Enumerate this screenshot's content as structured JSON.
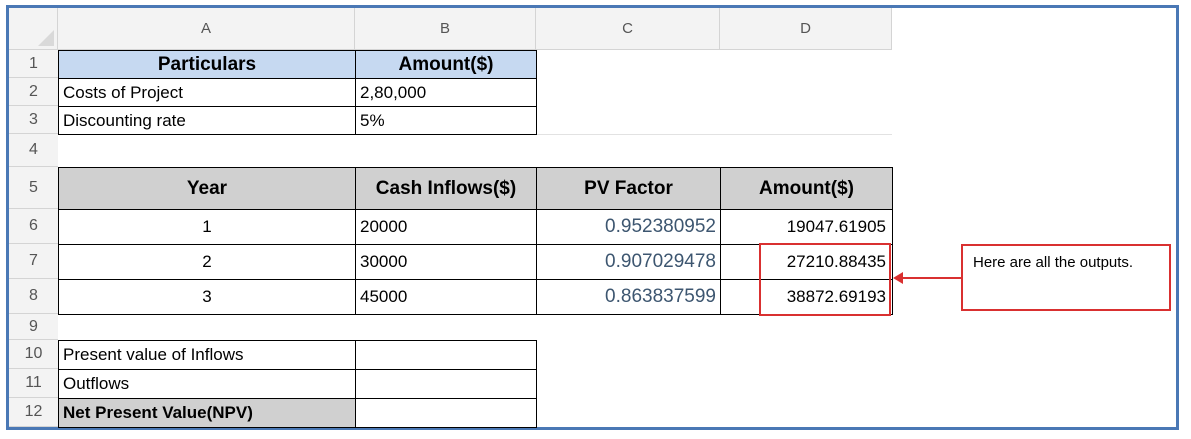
{
  "columns": [
    "A",
    "B",
    "C",
    "D"
  ],
  "rows": [
    "1",
    "2",
    "3",
    "4",
    "5",
    "6",
    "7",
    "8",
    "9",
    "10",
    "11",
    "12"
  ],
  "table1": {
    "header": {
      "particulars": "Particulars",
      "amount": "Amount($)"
    },
    "rows": [
      {
        "label": "Costs of Project",
        "value": "2,80,000"
      },
      {
        "label": "Discounting rate",
        "value": "5%"
      }
    ]
  },
  "table2": {
    "header": {
      "year": "Year",
      "cash": "Cash Inflows($)",
      "pv": "PV Factor",
      "amount": "Amount($)"
    },
    "rows": [
      {
        "year": "1",
        "cash": "20000",
        "pv": "0.952380952",
        "amount": "19047.61905"
      },
      {
        "year": "2",
        "cash": "30000",
        "pv": "0.907029478",
        "amount": "27210.88435"
      },
      {
        "year": "3",
        "cash": "45000",
        "pv": "0.863837599",
        "amount": "38872.69193"
      }
    ]
  },
  "table3": {
    "rows": [
      {
        "label": "Present value of Inflows",
        "value": ""
      },
      {
        "label": "Outflows",
        "value": ""
      },
      {
        "label": "Net Present Value(NPV)",
        "value": ""
      }
    ]
  },
  "callout": {
    "text": "Here are all the outputs.",
    "color": "#d93030"
  },
  "colors": {
    "header_blue": "#c6d9f1",
    "header_gray": "#d0d0d0",
    "frame": "#4a78b5"
  }
}
